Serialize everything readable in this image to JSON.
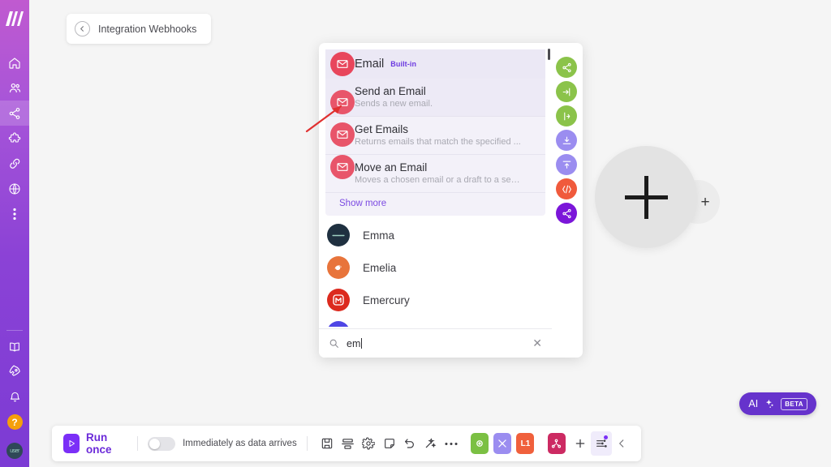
{
  "sidebar": {
    "logo_name": "make-logo",
    "items": [
      {
        "id": "home",
        "icon": "home-icon",
        "label": "Home"
      },
      {
        "id": "organization",
        "icon": "users-icon",
        "label": "Organization"
      },
      {
        "id": "scenarios",
        "icon": "share-nodes-icon",
        "label": "Scenarios",
        "active": true
      },
      {
        "id": "templates",
        "icon": "puzzle-icon",
        "label": "Templates"
      },
      {
        "id": "connections",
        "icon": "link-icon",
        "label": "Connections"
      },
      {
        "id": "webhooks",
        "icon": "globe-icon",
        "label": "Webhooks"
      },
      {
        "id": "more",
        "icon": "dots-vertical-icon",
        "label": "More"
      }
    ],
    "bottom_items": [
      {
        "id": "docs",
        "icon": "book-icon",
        "label": "Docs"
      },
      {
        "id": "whats-new",
        "icon": "rocket-icon",
        "label": "What's new"
      },
      {
        "id": "notifications",
        "icon": "bell-icon",
        "label": "Notifications"
      }
    ],
    "help_label": "?",
    "avatar_initials": "user"
  },
  "breadcrumb": {
    "back_icon": "arrow-left-circle-icon",
    "title": "Integration Webhooks"
  },
  "picker": {
    "app_group": {
      "icon": "envelope-icon",
      "title": "Email",
      "badge": "Built-in",
      "modules": [
        {
          "title": "Send an Email",
          "desc": "Sends a new email.",
          "icon": "envelope-icon",
          "hover": true
        },
        {
          "title": "Get Emails",
          "desc": "Returns emails that match the specified ...",
          "icon": "envelope-icon",
          "hover": false
        },
        {
          "title": "Move an Email",
          "desc": "Moves a chosen email or a draft to a sele...",
          "icon": "envelope-icon",
          "hover": false
        }
      ],
      "show_more": "Show more"
    },
    "apps": [
      {
        "name": "Emma",
        "avatar_color": "#1f3040",
        "glyph": "emma",
        "glyph_color": "#ffffff"
      },
      {
        "name": "Emelia",
        "avatar_color": "#e8743b",
        "glyph": "bird",
        "glyph_color": "#ffffff"
      },
      {
        "name": "Emercury",
        "avatar_color": "#dc2a1e",
        "glyph": "M",
        "glyph_color": "#ffffff"
      },
      {
        "name": "",
        "avatar_color": "#4f46e5",
        "glyph": "",
        "glyph_color": "#ffffff"
      }
    ],
    "search": {
      "icon": "search-icon",
      "value": "em",
      "placeholder": "Search",
      "clear_icon": "close-icon"
    }
  },
  "rail": [
    {
      "icon": "share-icon",
      "color": "#8bc34a"
    },
    {
      "icon": "sign-in-icon",
      "color": "#8bc34a"
    },
    {
      "icon": "router-icon",
      "color": "#8bc34a"
    },
    {
      "icon": "download-icon",
      "color": "#9b8df0"
    },
    {
      "icon": "upload-icon",
      "color": "#9b8df0"
    },
    {
      "icon": "code-icon",
      "color": "#f05a3c"
    },
    {
      "icon": "share-icon",
      "color": "#7b16d9"
    }
  ],
  "canvas": {
    "add_module_plus": "+",
    "add_side_plus": "+"
  },
  "ai_button": {
    "label": "AI",
    "sparkle_icon": "sparkle-icon",
    "badge": "BETA",
    "color": "#6633cc"
  },
  "toolbar": {
    "run_label": "Run once",
    "run_icon": "play-icon",
    "schedule_toggle_on": false,
    "schedule_label": "Immediately as data arrives",
    "icons": [
      {
        "id": "save",
        "icon": "save-icon"
      },
      {
        "id": "align",
        "icon": "align-icon"
      },
      {
        "id": "settings",
        "icon": "gear-icon"
      },
      {
        "id": "notes",
        "icon": "note-icon"
      },
      {
        "id": "undo",
        "icon": "undo-icon"
      },
      {
        "id": "auto-align",
        "icon": "magic-wand-icon"
      },
      {
        "id": "more",
        "icon": "ellipsis-icon"
      }
    ],
    "color_buttons": [
      {
        "id": "explore",
        "icon": "circle-icon",
        "label": "",
        "color": "#7bc043"
      },
      {
        "id": "tools",
        "icon": "tools-icon",
        "label": "",
        "color": "#9b8df0"
      },
      {
        "id": "level",
        "icon": "text-icon",
        "label": "L1",
        "color": "#f0603c"
      },
      {
        "id": "connect",
        "icon": "connector-icon",
        "label": "",
        "color": "#cc2a62"
      }
    ],
    "add_icon": "plus-icon",
    "filter_icon": "sliders-icon",
    "collapse_icon": "chevron-left-icon"
  }
}
